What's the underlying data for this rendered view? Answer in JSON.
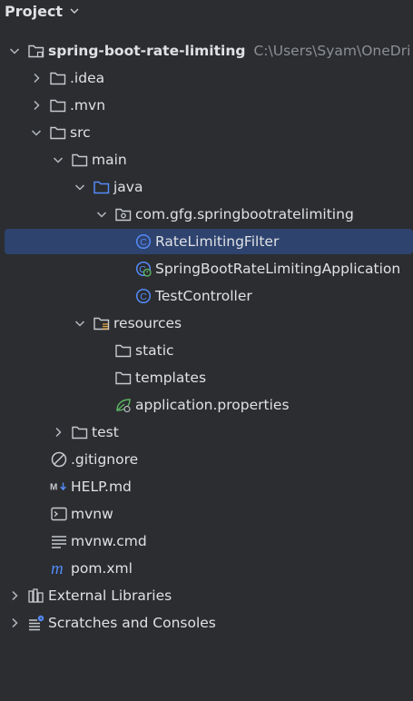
{
  "header": {
    "title": "Project"
  },
  "tree": {
    "root": {
      "name": "spring-boot-rate-limiting",
      "path": "C:\\Users\\Syam\\OneDri"
    },
    "idea": ".idea",
    "mvn": ".mvn",
    "src": "src",
    "main": "main",
    "java": "java",
    "package": "com.gfg.springbootratelimiting",
    "class1": "RateLimitingFilter",
    "class2": "SpringBootRateLimitingApplication",
    "class3": "TestController",
    "resources": "resources",
    "static": "static",
    "templates": "templates",
    "app_props": "application.properties",
    "test": "test",
    "gitignore": ".gitignore",
    "help": "HELP.md",
    "mvnw": "mvnw",
    "mvnw_cmd": "mvnw.cmd",
    "pom": "pom.xml",
    "ext_libs": "External Libraries",
    "scratches": "Scratches and Consoles"
  },
  "colors": {
    "background": "#2b2d30",
    "selection": "#2e436e",
    "text": "#dfe1e5",
    "path_text": "#8c8f94",
    "class_icon": "#548af7",
    "spring_leaf": "#5fb865"
  },
  "icons": {
    "folder": "folder-icon",
    "source_folder": "source-folder-icon",
    "package": "package-icon",
    "class": "class-icon",
    "spring_class": "spring-boot-class-icon",
    "resources_folder": "resources-folder-icon",
    "properties": "spring-properties-icon",
    "gitignore": "ignore-file-icon",
    "markdown": "markdown-icon",
    "shell": "shell-script-icon",
    "text_file": "text-file-icon",
    "maven": "maven-icon",
    "libraries": "libraries-icon",
    "scratches": "scratches-icon"
  }
}
